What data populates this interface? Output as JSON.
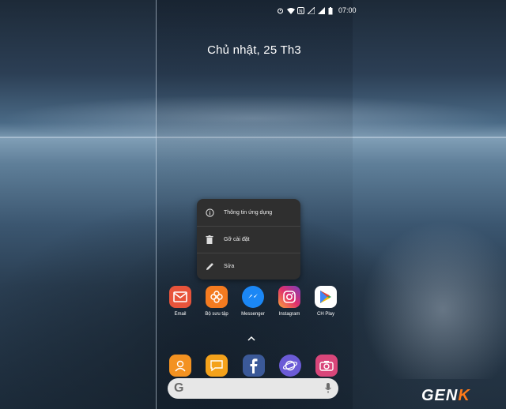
{
  "status_bar": {
    "time": "07:00"
  },
  "home": {
    "date": "Chủ nhật, 25 Th3"
  },
  "context_menu": {
    "items": [
      {
        "label": "Thông tin ứng dụng",
        "icon": "info-icon"
      },
      {
        "label": "Gỡ cài đặt",
        "icon": "trash-icon"
      },
      {
        "label": "Sửa",
        "icon": "pencil-icon"
      }
    ]
  },
  "apps": [
    {
      "label": "Email",
      "icon": "email-icon",
      "color": "#e8543b"
    },
    {
      "label": "Bộ sưu tập",
      "icon": "gallery-icon",
      "color": "#f47b20"
    },
    {
      "label": "Messenger",
      "icon": "messenger-icon",
      "color": "#1b87f5"
    },
    {
      "label": "Instagram",
      "icon": "instagram-icon",
      "color": "#c2307d"
    },
    {
      "label": "CH Play",
      "icon": "play-store-icon",
      "color": "#ffffff"
    }
  ],
  "dock": [
    {
      "icon": "contacts-icon",
      "color": "#f39221"
    },
    {
      "icon": "messages-icon",
      "color": "#f4a21b"
    },
    {
      "icon": "facebook-icon",
      "color": "#3b5998"
    },
    {
      "icon": "internet-icon",
      "color": "#6b5bd6"
    },
    {
      "icon": "camera-icon",
      "color": "#d9467a"
    }
  ],
  "search": {
    "logo": "G",
    "icon": "mic-icon"
  },
  "watermark": {
    "text_main": "GEN",
    "text_accent": "K"
  }
}
